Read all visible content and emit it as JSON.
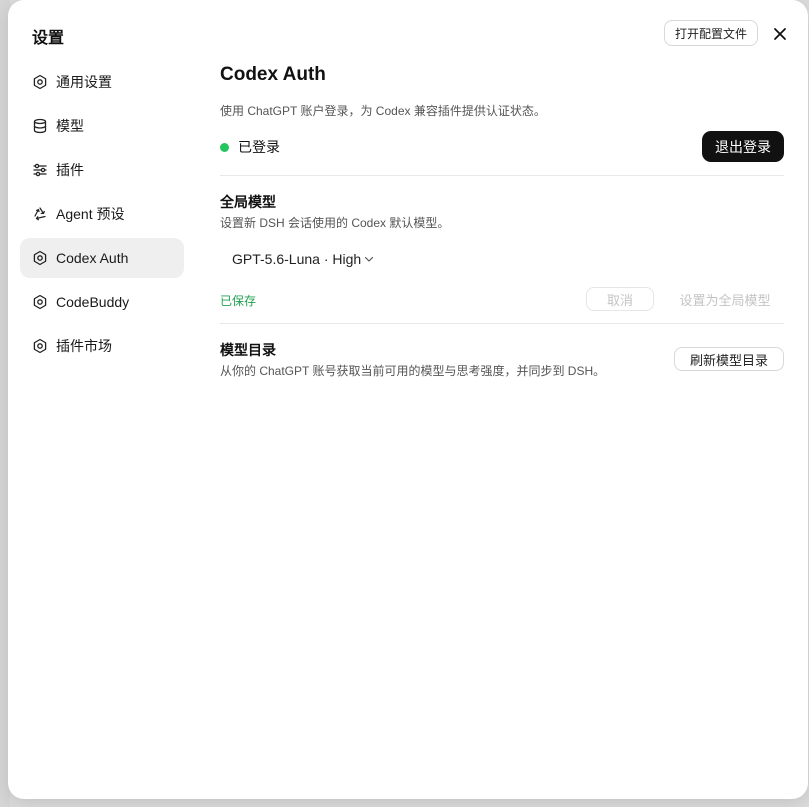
{
  "dialog": {
    "title": "设置",
    "open_config_label": "打开配置文件"
  },
  "sidebar": {
    "items": [
      {
        "label": "通用设置",
        "icon": "gear-icon"
      },
      {
        "label": "模型",
        "icon": "database-icon"
      },
      {
        "label": "插件",
        "icon": "sliders-icon"
      },
      {
        "label": "Agent 预设",
        "icon": "recycle-icon"
      },
      {
        "label": "Codex Auth",
        "icon": "gear-icon",
        "active": true
      },
      {
        "label": "CodeBuddy",
        "icon": "gear-icon"
      },
      {
        "label": "插件市场",
        "icon": "gear-icon"
      }
    ]
  },
  "main": {
    "title": "Codex Auth",
    "description": "使用 ChatGPT 账户登录，为 Codex 兼容插件提供认证状态。",
    "status": {
      "text": "已登录",
      "color": "#22c55e",
      "logout_label": "退出登录"
    },
    "global_model": {
      "title": "全局模型",
      "description": "设置新 DSH 会话使用的 Codex 默认模型。",
      "selected": "GPT-5.6-Luna · High",
      "saved_text": "已保存",
      "cancel_label": "取消",
      "set_global_label": "设置为全局模型"
    },
    "catalog": {
      "title": "模型目录",
      "description": "从你的 ChatGPT 账号获取当前可用的模型与思考强度，并同步到 DSH。",
      "refresh_label": "刷新模型目录"
    }
  },
  "colors": {
    "accent_dark": "#111111",
    "success": "#22c55e",
    "active_nav_bg": "#efeff0"
  }
}
